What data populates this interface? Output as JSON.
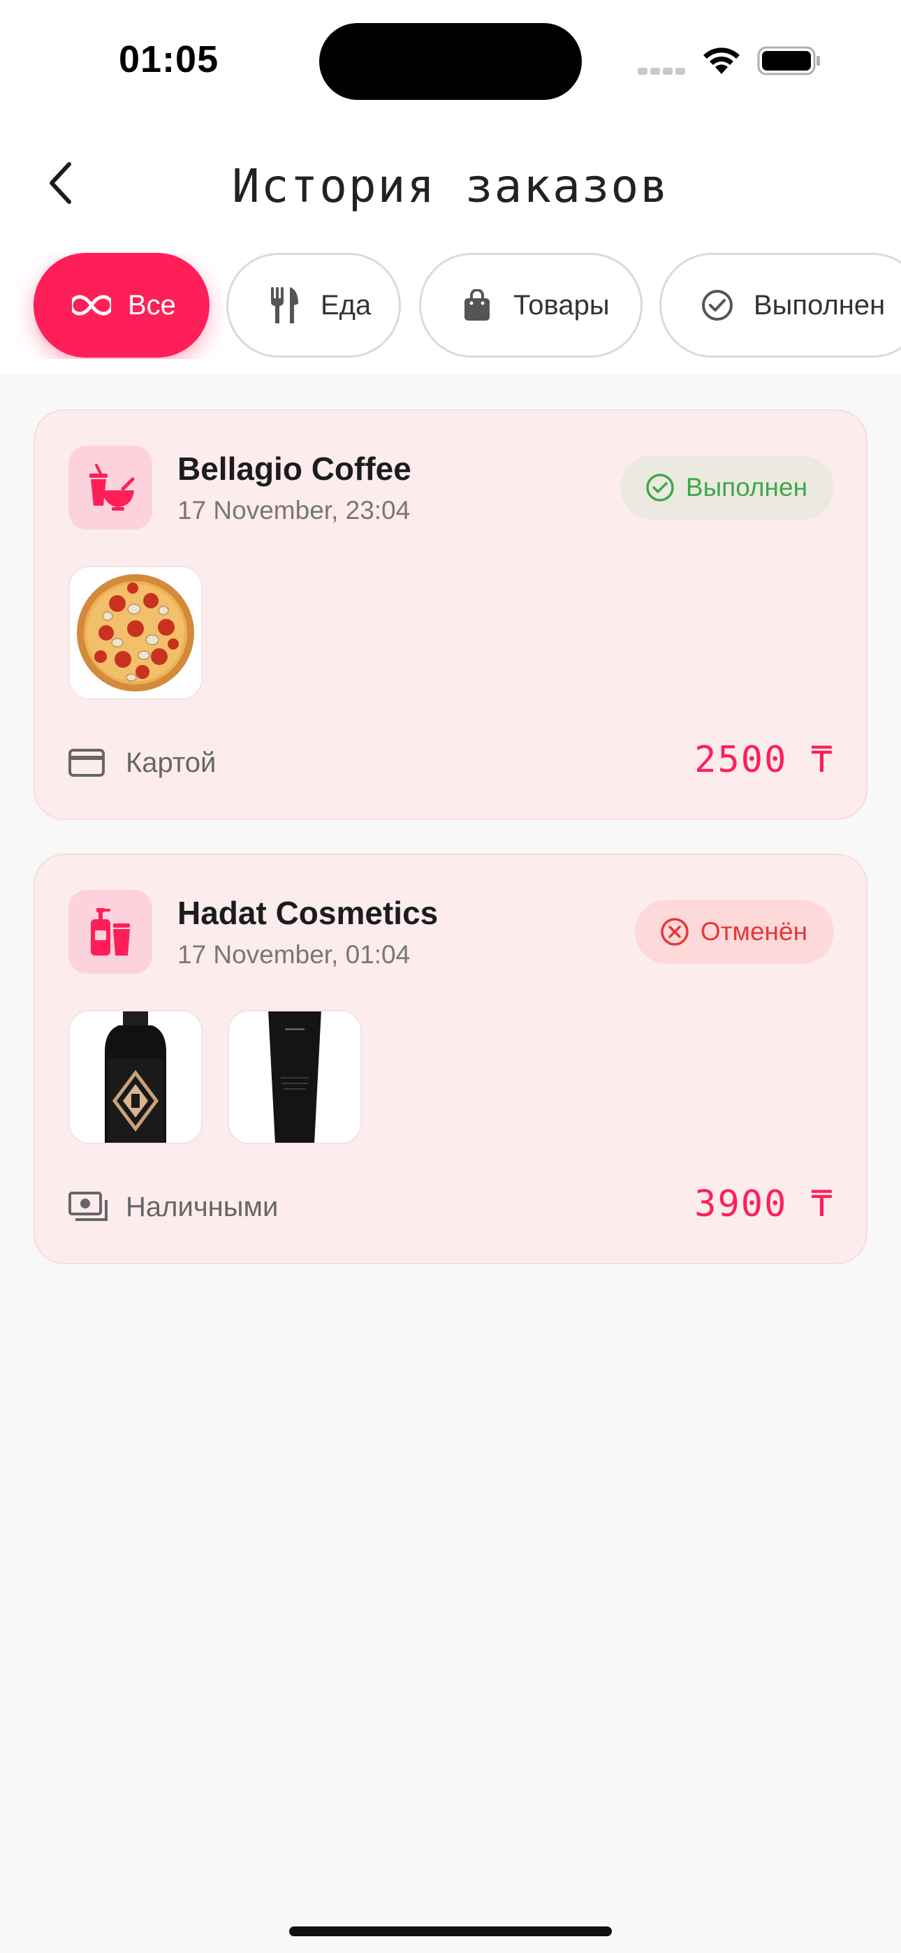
{
  "status_bar": {
    "time": "01:05"
  },
  "header": {
    "title": "История заказов"
  },
  "filters": [
    {
      "label": "Все",
      "icon": "infinity-icon",
      "active": true
    },
    {
      "label": "Еда",
      "icon": "fork-knife-icon",
      "active": false
    },
    {
      "label": "Товары",
      "icon": "shopping-bag-icon",
      "active": false
    },
    {
      "label": "Выполнен",
      "icon": "check-circle-icon",
      "active": false
    }
  ],
  "orders": [
    {
      "store": "Bellagio Coffee",
      "date": "17 November, 23:04",
      "store_icon": "food-drink-icon",
      "status": "Выполнен",
      "status_icon": "check-circle-icon",
      "items": [
        "pizza"
      ],
      "payment": "Картой",
      "payment_icon": "credit-card-icon",
      "price": "2500 ₸"
    },
    {
      "store": "Hadat Cosmetics",
      "date": "17 November, 01:04",
      "store_icon": "cosmetics-icon",
      "status": "Отменён",
      "status_icon": "x-circle-icon",
      "items": [
        "cosmetics-bottle",
        "cosmetics-tube"
      ],
      "payment": "Наличными",
      "payment_icon": "cash-icon",
      "price": "3900 ₸"
    }
  ],
  "colors": {
    "accent": "#ff1f58",
    "card_background": "#fdeced",
    "status_done": "#3da84a",
    "status_cancel": "#e8363a"
  }
}
